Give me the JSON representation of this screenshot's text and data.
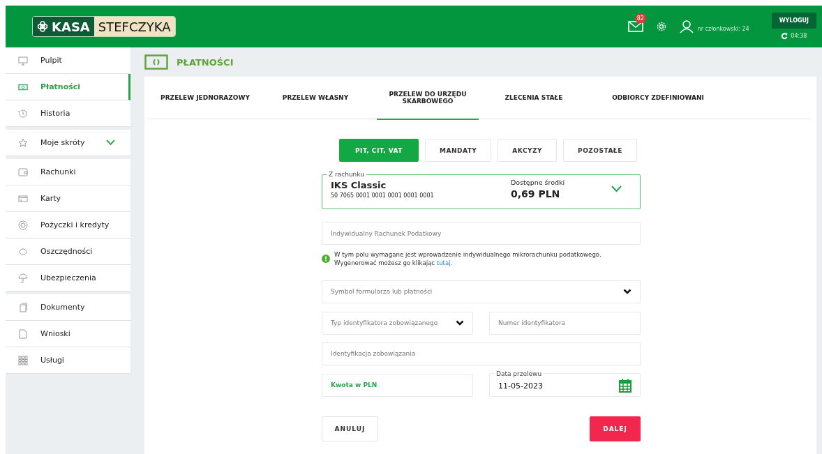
{
  "header": {
    "logo": {
      "left": "KASA",
      "right": "STEFCZYKA"
    },
    "messages_badge": "82",
    "member": "nr członkowski: 24",
    "logout": "WYLOGUJ",
    "session_time": "04:38"
  },
  "sidebar": {
    "groups": [
      {
        "items": [
          {
            "label": "Pulpit",
            "selected": false
          },
          {
            "label": "Płatności",
            "selected": true
          },
          {
            "label": "Historia",
            "selected": false
          }
        ]
      },
      {
        "items": [
          {
            "label": "Moje skróty",
            "selected": false,
            "expandable": true
          }
        ]
      },
      {
        "items": [
          {
            "label": "Rachunki",
            "selected": false
          },
          {
            "label": "Karty",
            "selected": false
          },
          {
            "label": "Pożyczki i kredyty",
            "selected": false
          },
          {
            "label": "Oszczędności",
            "selected": false
          },
          {
            "label": "Ubezpieczenia",
            "selected": false
          }
        ]
      },
      {
        "items": [
          {
            "label": "Dokumenty",
            "selected": false
          },
          {
            "label": "Wnioski",
            "selected": false
          },
          {
            "label": "Usługi",
            "selected": false
          }
        ]
      }
    ]
  },
  "page_title": "PŁATNOŚCI",
  "tabs": [
    {
      "label": "PRZELEW JEDNORAZOWY",
      "selected": false
    },
    {
      "label": "PRZELEW WŁASNY",
      "selected": false
    },
    {
      "label": "PRZELEW DO URZĘDU SKARBOWEGO",
      "selected": true
    },
    {
      "label": "ZLECENIA STAŁE",
      "selected": false
    },
    {
      "label": "ODBIORCY ZDEFINIOWANI",
      "selected": false
    }
  ],
  "subtabs": [
    {
      "label": "PIT, CIT, VAT",
      "selected": true
    },
    {
      "label": "MANDATY",
      "selected": false
    },
    {
      "label": "AKCYZY",
      "selected": false
    },
    {
      "label": "POZOSTAŁE",
      "selected": false
    }
  ],
  "account": {
    "legend": "Z rachunku",
    "name": "IKS Classic",
    "number": "50 7065 0001 0001 0001 0001 0001",
    "funds_label": "Dostępne środki",
    "funds": "0,69 PLN"
  },
  "tax_account": {
    "placeholder": "Indywidualny Rachunek Podatkowy"
  },
  "info": {
    "text": "W tym polu wymagane jest wprowadzenie indywidualnego mikrorachunku podatkowego. Wygenerować możesz go klikając",
    "link": "tutaj",
    "end": "."
  },
  "form_symbol": {
    "placeholder": "Symbol formularza lub płatności"
  },
  "id_type": {
    "placeholder": "Typ identyfikatora zobowiązanego"
  },
  "id_number": {
    "placeholder": "Numer identyfikatora"
  },
  "obligation": {
    "placeholder": "Identyfikacja zobowiązania"
  },
  "amount": {
    "placeholder": "Kwota w PLN"
  },
  "date": {
    "legend": "Data przelewu",
    "value": "11-05-2023"
  },
  "buttons": {
    "cancel": "ANULUJ",
    "next": "DALEJ"
  }
}
